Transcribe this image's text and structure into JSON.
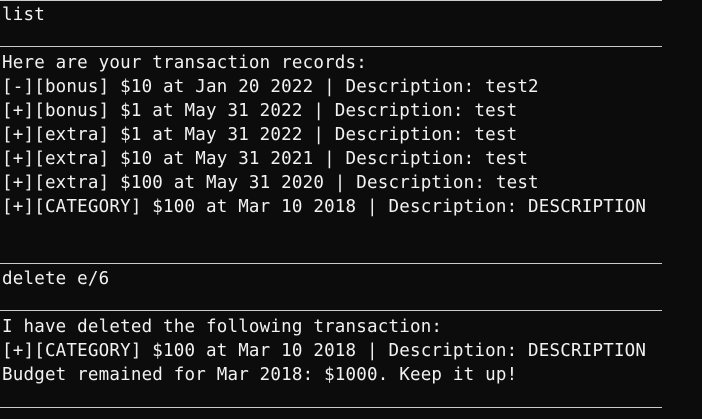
{
  "terminal": {
    "background": "#0c0c0c",
    "foreground": "#f2f2f2",
    "block1": {
      "command": "list",
      "header": "Here are your transaction records:",
      "records": [
        "[-][bonus] $10 at Jan 20 2022 | Description: test2",
        "[+][bonus] $1 at May 31 2022 | Description: test",
        "[+][extra] $1 at May 31 2022 | Description: test",
        "[+][extra] $10 at May 31 2021 | Description: test",
        "[+][extra] $100 at May 31 2020 | Description: test",
        "[+][CATEGORY] $100 at Mar 10 2018 | Description: DESCRIPTION"
      ]
    },
    "block2": {
      "command": "delete e/6",
      "header": "I have deleted the following transaction:",
      "deleted": "[+][CATEGORY] $100 at Mar 10 2018 | Description: DESCRIPTION",
      "budget": "Budget remained for Mar 2018: $1000. Keep it up!"
    }
  }
}
